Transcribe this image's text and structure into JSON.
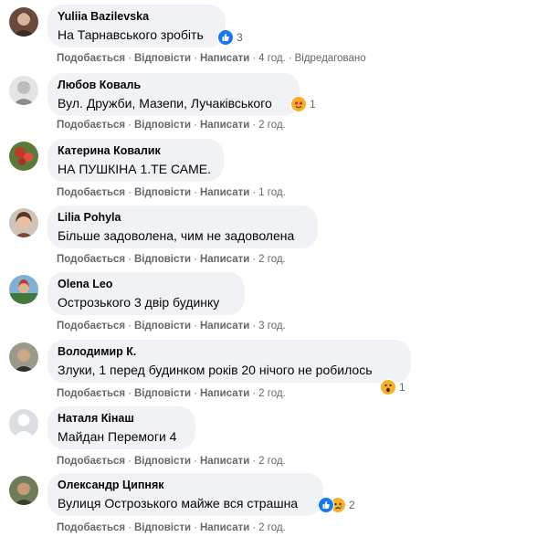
{
  "actions": {
    "like": "Подобається",
    "reply": "Відповісти",
    "write": "Написати",
    "edited": "Відредаговано"
  },
  "comments": [
    {
      "author": "Yuliia Bazilevska",
      "text": "На Тарнавського зробіть",
      "time": "4 год.",
      "edited": true,
      "reaction_count": "3",
      "reaction": "like-icon"
    },
    {
      "author": "Любов Коваль",
      "text": "Вул. Дружби, Мазепи, Лучаківського",
      "time": "2 год.",
      "edited": false,
      "reaction_count": "1",
      "reaction": "love-face-icon"
    },
    {
      "author": "Катерина Ковалик",
      "text": "НА ПУШКІНА 1.ТЕ САМЕ.",
      "time": "1 год.",
      "edited": false
    },
    {
      "author": "Lilia Pohyla",
      "text": "Більше задоволена, чим не задоволена",
      "time": "2 год.",
      "edited": false
    },
    {
      "author": "Olena Leo",
      "text": "Острозького 3 двір будинку",
      "time": "3 год.",
      "edited": false
    },
    {
      "author": "Володимир К.",
      "text": "Злуки, 1 перед будинком років 20 нічого не робилось",
      "time": "2 год.",
      "edited": false,
      "reaction_count": "1",
      "reaction": "wow-icon"
    },
    {
      "author": "Наталя Кінаш",
      "text": "Майдан Перемоги 4",
      "time": "2 год.",
      "edited": false
    },
    {
      "author": "Олександр Ципняк",
      "text": "Вулиця Острозького майже вся страшна",
      "time": "2 год.",
      "edited": false,
      "reaction_count": "2",
      "reaction": "like-sad-icon"
    }
  ]
}
